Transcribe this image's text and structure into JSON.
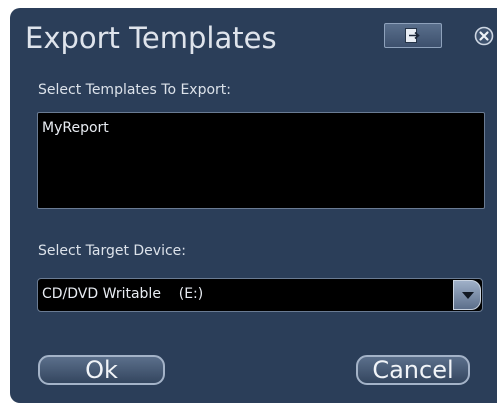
{
  "dialog": {
    "title": "Export Templates",
    "restore_icon": "restore-window-icon",
    "close_icon": "close-icon"
  },
  "templates": {
    "label": "Select Templates To Export:",
    "items": [
      "MyReport"
    ]
  },
  "device": {
    "label": "Select Target Device:",
    "selected": "CD/DVD Writable    (E:)",
    "dropdown_icon": "chevron-down-icon"
  },
  "buttons": {
    "ok": "Ok",
    "cancel": "Cancel"
  },
  "colors": {
    "dialog_background": "#2b3e59",
    "field_background": "#000000",
    "text": "#dce2ea"
  }
}
